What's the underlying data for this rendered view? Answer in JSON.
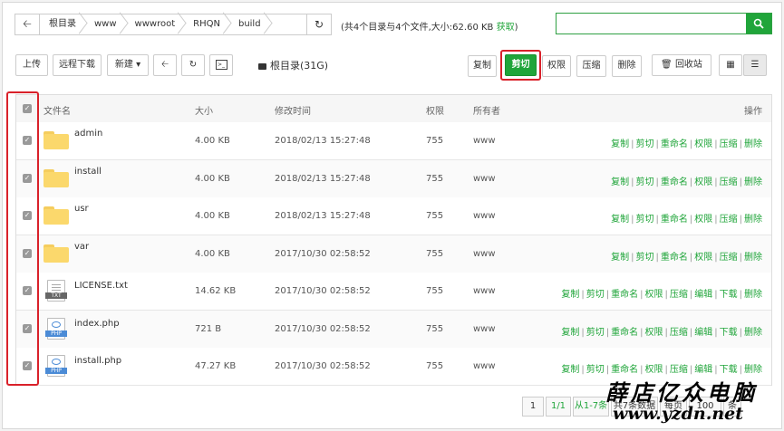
{
  "path": {
    "crumbs": [
      "根目录",
      "www",
      "wwwroot",
      "RHQN",
      "build"
    ]
  },
  "summary": {
    "text": "(共4个目录与4个文件,大小:62.60 KB ",
    "get_label": "获取",
    "close": ")"
  },
  "search": {
    "placeholder": ""
  },
  "toolbar": {
    "upload": "上传",
    "remote_download": "远程下载",
    "new": "新建",
    "disk": "根目录(31G)",
    "copy": "复制",
    "cut": "剪切",
    "perm": "权限",
    "compress": "压缩",
    "delete": "删除",
    "recycle": "回收站"
  },
  "table": {
    "headers": {
      "name": "文件名",
      "size": "大小",
      "mtime": "修改时间",
      "perm": "权限",
      "owner": "所有者",
      "ops": "操作"
    },
    "rows": [
      {
        "type": "folder",
        "name": "admin",
        "size": "4.00 KB",
        "mtime": "2018/02/13 15:27:48",
        "perm": "755",
        "owner": "www"
      },
      {
        "type": "folder",
        "name": "install",
        "size": "4.00 KB",
        "mtime": "2018/02/13 15:27:48",
        "perm": "755",
        "owner": "www"
      },
      {
        "type": "folder",
        "name": "usr",
        "size": "4.00 KB",
        "mtime": "2018/02/13 15:27:48",
        "perm": "755",
        "owner": "www"
      },
      {
        "type": "folder",
        "name": "var",
        "size": "4.00 KB",
        "mtime": "2017/10/30 02:58:52",
        "perm": "755",
        "owner": "www"
      },
      {
        "type": "txt",
        "name": "LICENSE.txt",
        "size": "14.62 KB",
        "mtime": "2017/10/30 02:58:52",
        "perm": "755",
        "owner": "www"
      },
      {
        "type": "php",
        "name": "index.php",
        "size": "721 B",
        "mtime": "2017/10/30 02:58:52",
        "perm": "755",
        "owner": "www"
      },
      {
        "type": "php",
        "name": "install.php",
        "size": "47.27 KB",
        "mtime": "2017/10/30 02:58:52",
        "perm": "755",
        "owner": "www"
      }
    ],
    "folder_ops": [
      "复制",
      "剪切",
      "重命名",
      "权限",
      "压缩",
      "删除"
    ],
    "file_ops": [
      "复制",
      "剪切",
      "重命名",
      "权限",
      "压缩",
      "编辑",
      "下载",
      "删除"
    ],
    "file_tags": {
      "txt": "TXT",
      "php": "PHP"
    }
  },
  "pager": {
    "page": "1",
    "pages": "1/1",
    "range": "从1-7条",
    "total": "共7条数据",
    "per_page_label": "每页",
    "per_page": "100",
    "unit": "条"
  },
  "watermark": {
    "title": "薛店亿众电脑",
    "url": "www.yzdn.net"
  },
  "colors": {
    "accent": "#20a53a",
    "highlight": "#d9212a"
  }
}
